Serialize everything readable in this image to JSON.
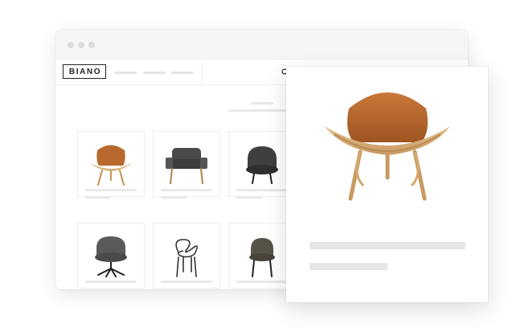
{
  "header": {
    "logo_text": "BIANO"
  },
  "icons": {
    "search": "search-icon",
    "window_controls": [
      "window-dot-icon",
      "window-dot-icon",
      "window-dot-icon"
    ]
  },
  "products": [
    {
      "name": "shell-lounge-chair-icon",
      "color": "#b86a2e"
    },
    {
      "name": "dark-armchair-icon",
      "color": "#4a4a4a"
    },
    {
      "name": "round-armchair-icon",
      "color": "#3f3f3f"
    },
    {
      "name": "swivel-armchair-icon",
      "color": "#5a5a5a"
    },
    {
      "name": "wire-chair-icon",
      "color": "#333333"
    },
    {
      "name": "olive-chair-icon",
      "color": "#565247"
    }
  ],
  "preview": {
    "product": "shell-lounge-chair-icon",
    "colors": {
      "leather": "#b4672b",
      "wood": "#d9b07a"
    }
  }
}
